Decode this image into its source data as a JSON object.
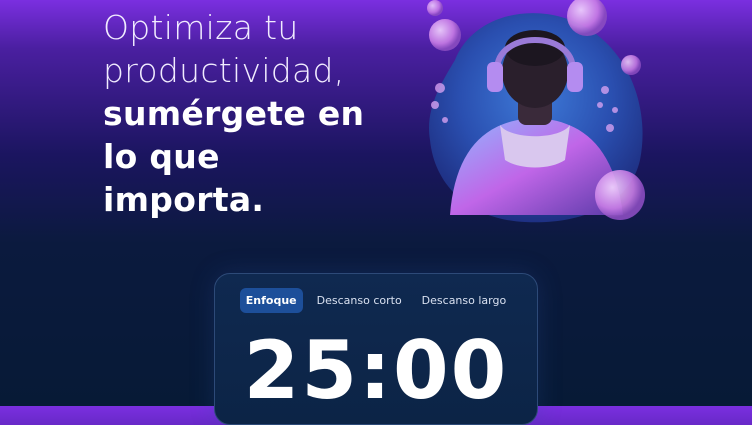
{
  "hero": {
    "line1": "Optimiza tu",
    "line2": "productividad,",
    "line3": "sumérgete en",
    "line4": "lo que",
    "line5": "importa."
  },
  "illustration": {
    "icon": "person-headphones-bubbles-illustration"
  },
  "timer": {
    "tabs": [
      "Enfoque",
      "Descanso corto",
      "Descanso largo"
    ],
    "active_tab": "Enfoque",
    "time": "25:00"
  },
  "colors": {
    "background_top": "#7b2fe0",
    "background_bottom": "#071a36",
    "tab_active": "#1d4f9a",
    "card_border": "#2d4a78"
  }
}
